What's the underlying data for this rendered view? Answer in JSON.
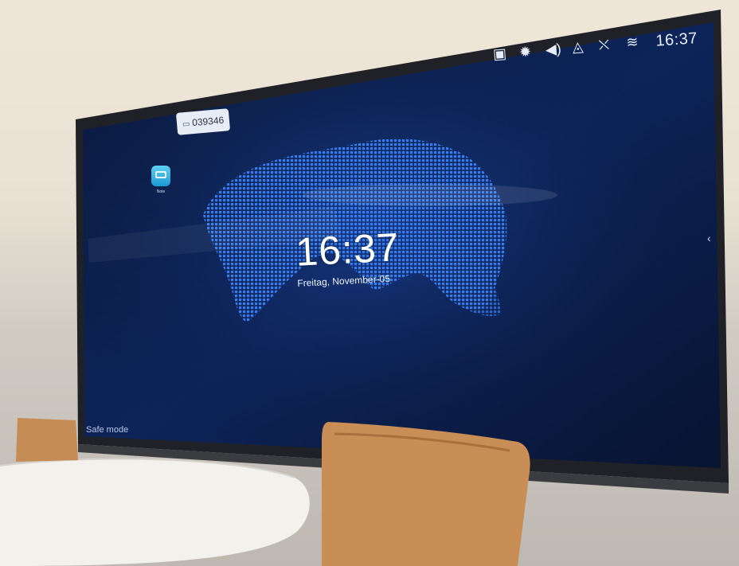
{
  "scene_description_free": true,
  "status_bar": {
    "icons": [
      "screen-mirror-icon",
      "brightness-icon",
      "volume-icon",
      "signal-icon",
      "network-icon",
      "wifi-icon"
    ],
    "time": "16:37"
  },
  "id_tag": {
    "icon": "screen-icon",
    "code": "039346"
  },
  "desktop": {
    "app_label": "Note"
  },
  "lockscreen": {
    "time": "16:37",
    "date": "Freitag, November-05"
  },
  "footer": {
    "safe_mode": "Safe mode"
  },
  "side": {
    "arrow": "chevron-left-icon"
  },
  "colors": {
    "screen_dark": "#0a1633",
    "screen_glow": "#1b3f8f",
    "map_dots": "#3f8cff",
    "wall": "#efe6d8"
  }
}
